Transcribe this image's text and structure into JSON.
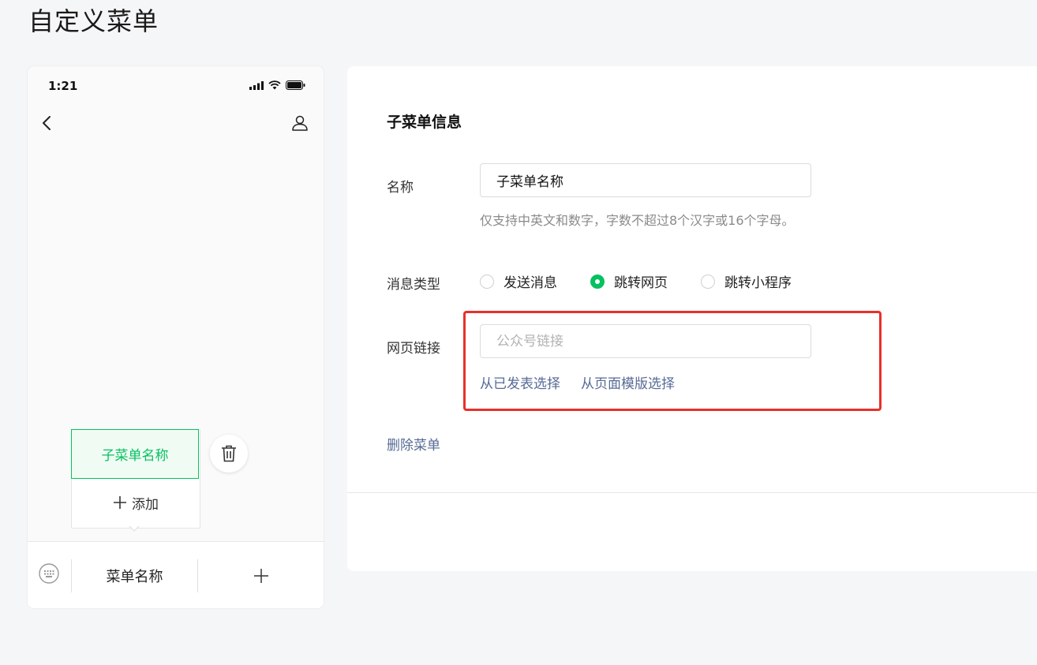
{
  "page": {
    "title": "自定义菜单"
  },
  "phone": {
    "status_time": "1:21",
    "submenu": {
      "item_label": "子菜单名称",
      "add_label": "添加"
    },
    "menubar": {
      "menu_label": "菜单名称"
    }
  },
  "form": {
    "section_title": "子菜单信息",
    "name": {
      "label": "名称",
      "value": "子菜单名称",
      "hint": "仅支持中英文和数字，字数不超过8个汉字或16个字母。"
    },
    "message_type": {
      "label": "消息类型",
      "options": [
        {
          "label": "发送消息",
          "selected": false
        },
        {
          "label": "跳转网页",
          "selected": true
        },
        {
          "label": "跳转小程序",
          "selected": false
        }
      ]
    },
    "web_link": {
      "label": "网页链接",
      "placeholder": "公众号链接",
      "value": "",
      "select_published": "从已发表选择",
      "select_template": "从页面模版选择"
    },
    "delete_label": "删除菜单"
  },
  "colors": {
    "accent": "#07c160",
    "link": "#576b95",
    "highlight": "#e8302a"
  }
}
